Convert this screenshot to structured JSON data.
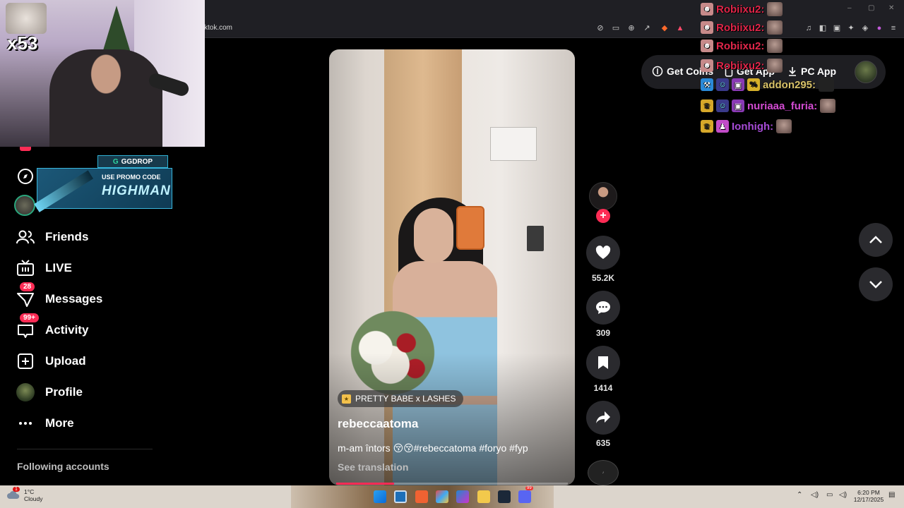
{
  "browser": {
    "url": "ktok.com",
    "window_controls": [
      "–",
      "▢",
      "✕"
    ]
  },
  "topbar": {
    "get_coins": "Get Coins",
    "get_app": "Get App",
    "pc_app": "PC App"
  },
  "webcam": {
    "count": "x53"
  },
  "promo": {
    "brand": "GGDROP",
    "line1": "USE PROMO CODE",
    "code": "HIGHMAN"
  },
  "sidebar": {
    "items": [
      {
        "label": "Friends",
        "icon": "friends-icon"
      },
      {
        "label": "LIVE",
        "icon": "live-icon"
      },
      {
        "label": "Messages",
        "icon": "messages-icon",
        "badge": "28"
      },
      {
        "label": "Activity",
        "icon": "activity-icon",
        "badge": "99+"
      },
      {
        "label": "Upload",
        "icon": "upload-icon"
      },
      {
        "label": "Profile",
        "icon": "profile-avatar"
      },
      {
        "label": "More",
        "icon": "more-icon"
      }
    ],
    "following_header": "Following accounts"
  },
  "video": {
    "sound": "PRETTY BABE x LASHES",
    "username": "rebeccaatoma",
    "caption": "m-am întors 😚😚#rebeccatoma #foryo #fyp",
    "see_translation": "See translation",
    "progress": 0.25
  },
  "actions": {
    "likes": "55.2K",
    "comments": "309",
    "saves": "1414",
    "shares": "635"
  },
  "chat": [
    {
      "user": "Robiixu2:",
      "color": "#e0264a"
    },
    {
      "user": "Robiixu2:",
      "color": "#e0264a"
    },
    {
      "user": "Robiixu2:",
      "color": "#e0264a"
    },
    {
      "user": "Robiixu2:",
      "color": "#e0264a"
    },
    {
      "user": "addon295:",
      "color": "#d9c36a"
    },
    {
      "user": "nuriaaa_furia:",
      "color": "#d24bd1"
    },
    {
      "user": "Ionhigh:",
      "color": "#a64bd6"
    }
  ],
  "taskbar": {
    "weather_temp": "1°C",
    "weather_desc": "Cloudy",
    "weather_badge": "1",
    "time": "6:20 PM",
    "date": "12/17/2025",
    "discord_badge": "99"
  }
}
